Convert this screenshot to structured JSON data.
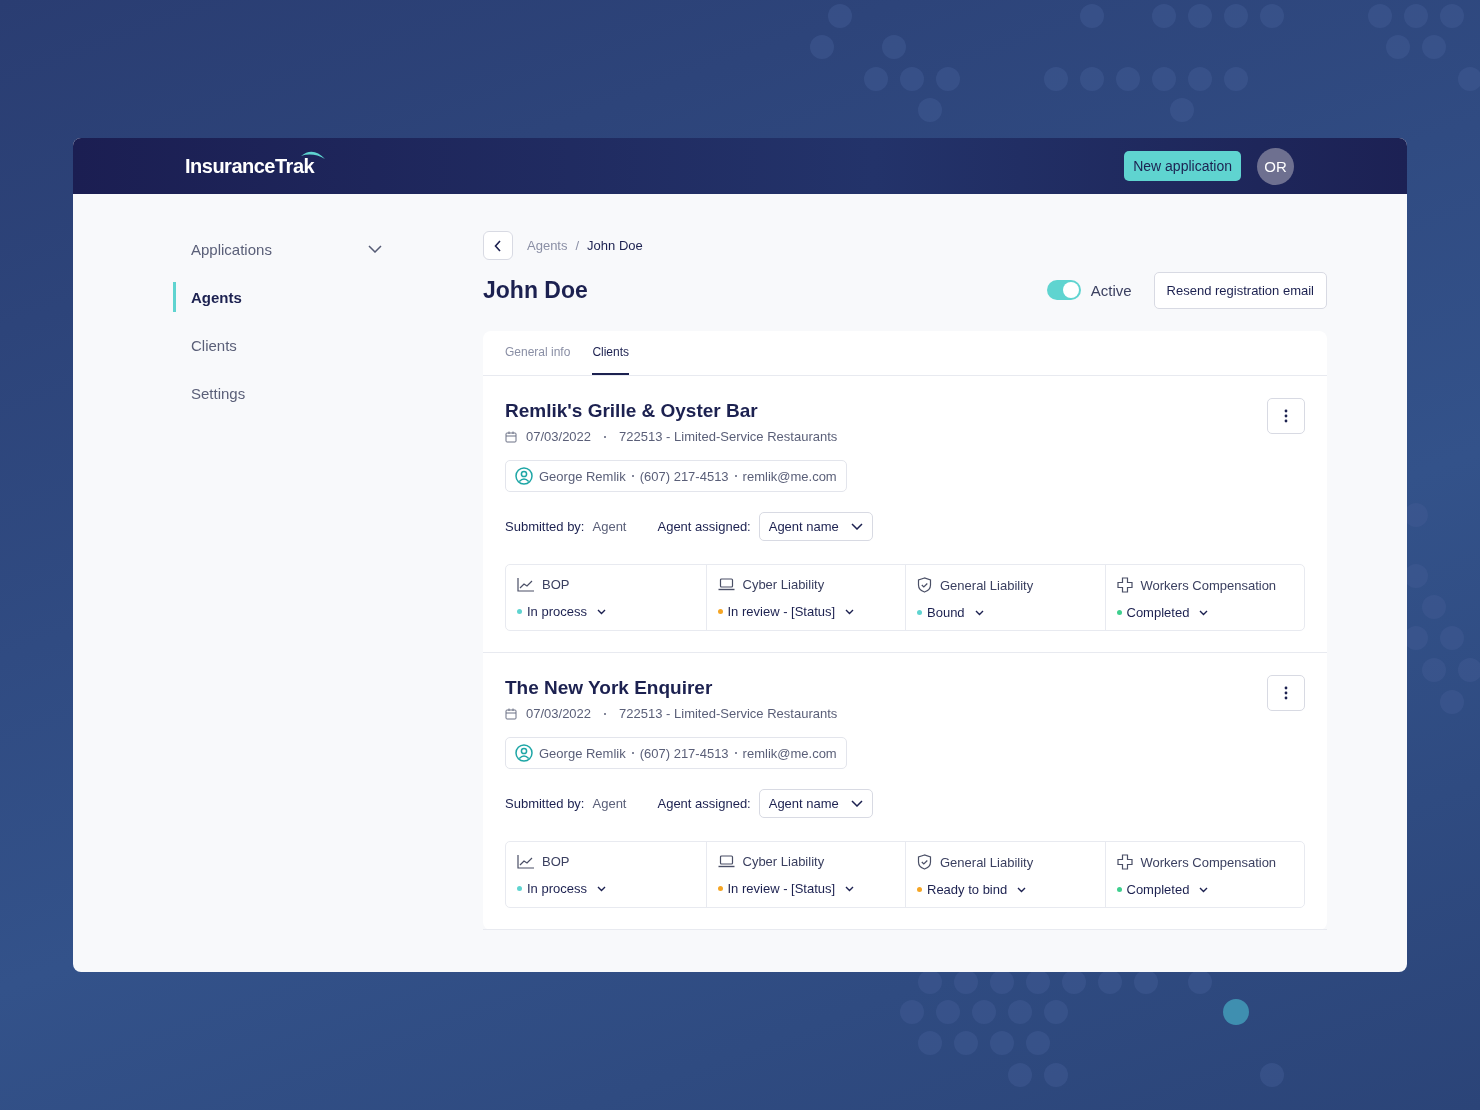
{
  "header": {
    "logo": "InsuranceTrak",
    "new_button": "New application",
    "avatar": "OR"
  },
  "sidebar": {
    "items": [
      {
        "label": "Applications",
        "kind": "group",
        "selected": false
      },
      {
        "label": "Agents",
        "kind": "link",
        "selected": true
      },
      {
        "label": "Clients",
        "kind": "link",
        "selected": false
      },
      {
        "label": "Settings",
        "kind": "link",
        "selected": false
      }
    ]
  },
  "breadcrumb": [
    "Agents",
    "John Doe"
  ],
  "breadcrumb_separator": "/",
  "title": "John Doe",
  "status_toggle": {
    "label": "Active",
    "on": true
  },
  "resend_button": "Resend registration email",
  "tabs": [
    {
      "label": "General info",
      "selected": false
    },
    {
      "label": "Clients",
      "selected": true
    }
  ],
  "clients": [
    {
      "name": "Remlik's Grille & Oyster Bar",
      "date": "07/03/2022",
      "industry": "722513 - Limited-Service Restaurants",
      "contact": [
        "George Remlik",
        "(607) 217-4513",
        "remlik@me.com"
      ],
      "submitted_label": "Submitted by:",
      "submitted_value": "Agent",
      "assigned_label": "Agent assigned:",
      "assigned_value": "Agent name",
      "policies": [
        {
          "kind": "chart",
          "name": "BOP",
          "status": "In process",
          "color": "#5fd4d0"
        },
        {
          "kind": "laptop",
          "name": "Cyber Liability",
          "status": "In review - [Status]",
          "color": "#f5a524"
        },
        {
          "kind": "shield",
          "name": "General Liability",
          "status": "Bound",
          "color": "#5fd4d0"
        },
        {
          "kind": "cross",
          "name": "Workers Compensation",
          "status": "Completed",
          "color": "#3ecf8e"
        }
      ]
    },
    {
      "name": "The New York Enquirer",
      "date": "07/03/2022",
      "industry": "722513 - Limited-Service Restaurants",
      "contact": [
        "George Remlik",
        "(607) 217-4513",
        "remlik@me.com"
      ],
      "submitted_label": "Submitted by:",
      "submitted_value": "Agent",
      "assigned_label": "Agent assigned:",
      "assigned_value": "Agent name",
      "policies": [
        {
          "kind": "chart",
          "name": "BOP",
          "status": "In process",
          "color": "#5fd4d0"
        },
        {
          "kind": "laptop",
          "name": "Cyber Liability",
          "status": "In review - [Status]",
          "color": "#f5a524"
        },
        {
          "kind": "shield",
          "name": "General Liability",
          "status": "Ready to bind",
          "color": "#f5a524"
        },
        {
          "kind": "cross",
          "name": "Workers Compensation",
          "status": "Completed",
          "color": "#3ecf8e"
        }
      ]
    }
  ]
}
